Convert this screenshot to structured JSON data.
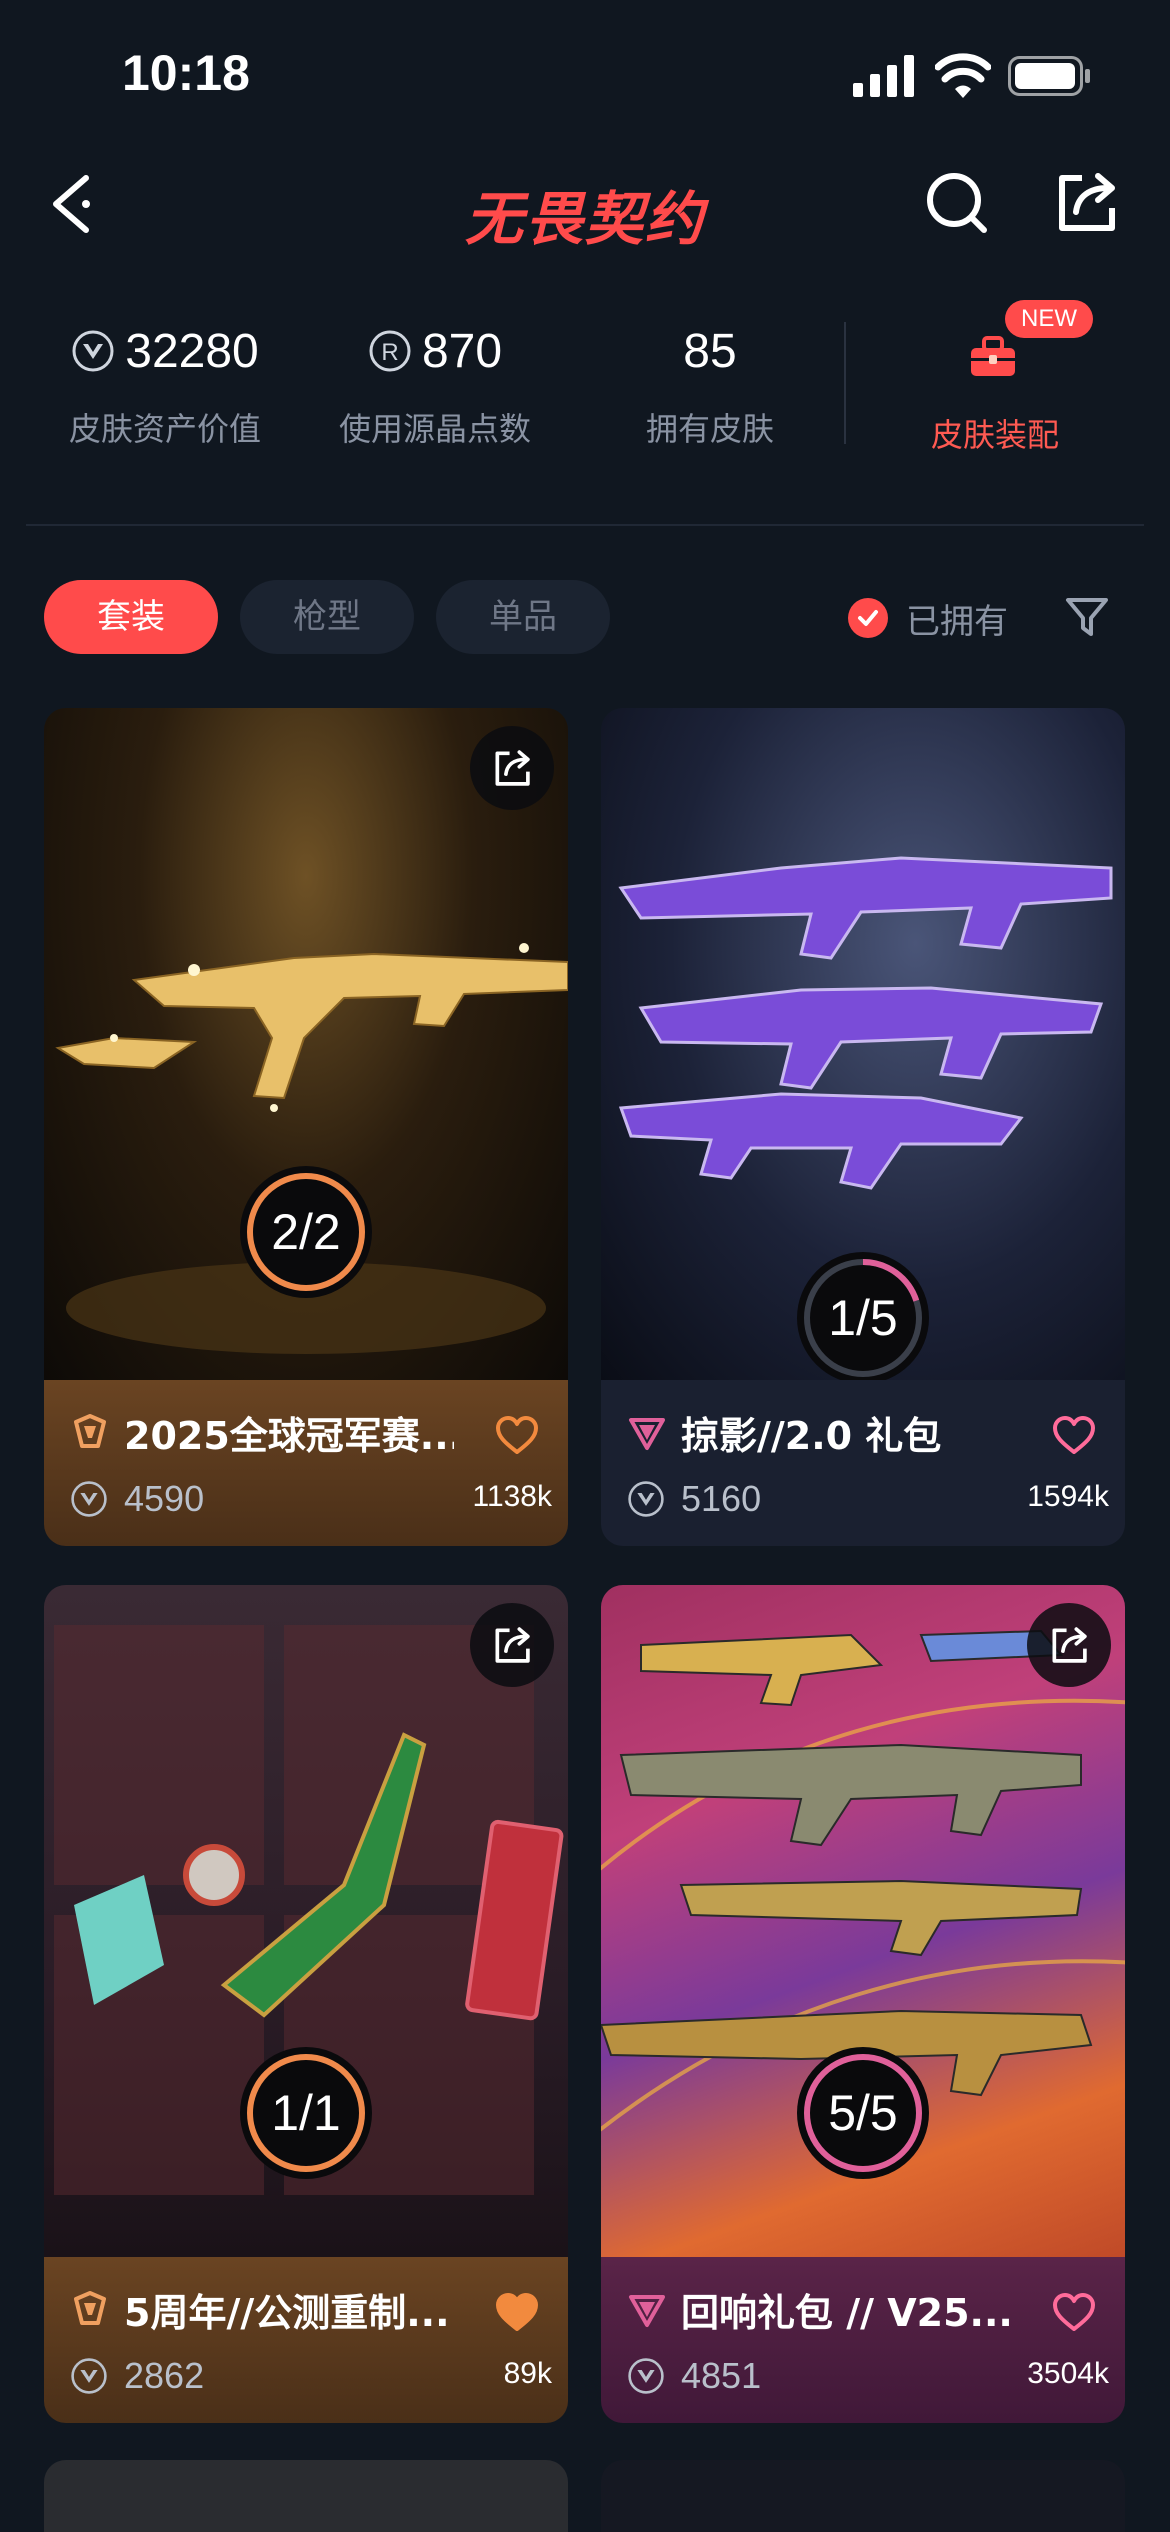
{
  "status_bar": {
    "time": "10:18",
    "icons": [
      "signal-icon",
      "wifi-icon",
      "battery-icon"
    ]
  },
  "header": {
    "title": "无畏契约",
    "back_icon": "chevron-left-icon",
    "search_icon": "search-icon",
    "share_icon": "share-icon"
  },
  "stats": [
    {
      "value": "32280",
      "label": "皮肤资产价值",
      "icon": "vp-icon"
    },
    {
      "value": "870",
      "label": "使用源晶点数",
      "icon": "radianite-icon"
    },
    {
      "value": "85",
      "label": "拥有皮肤"
    }
  ],
  "equip": {
    "label": "皮肤装配",
    "badge": "NEW",
    "icon": "toolbox-icon"
  },
  "tabs": [
    {
      "label": "套装",
      "active": true
    },
    {
      "label": "枪型",
      "active": false
    },
    {
      "label": "单品",
      "active": false
    }
  ],
  "owned_filter": {
    "label": "已拥有",
    "checked": true
  },
  "cards": [
    {
      "title": "2025全球冠军赛...",
      "progress_label": "2/2",
      "progress": 1.0,
      "price": "4590",
      "likes": "1138k",
      "liked": false,
      "tier_color": "#f0a060"
    },
    {
      "title": "掠影//2.0 礼包",
      "progress_label": "1/5",
      "progress": 0.2,
      "price": "5160",
      "likes": "1594k",
      "liked": false,
      "tier_color": "#e0609a"
    },
    {
      "title": "5周年//公测重制...",
      "progress_label": "1/1",
      "progress": 1.0,
      "price": "2862",
      "likes": "89k",
      "liked": true,
      "tier_color": "#f0a060"
    },
    {
      "title": "回响礼包 // V25...",
      "progress_label": "5/5",
      "progress": 1.0,
      "price": "4851",
      "likes": "3504k",
      "liked": false,
      "tier_color": "#e0609a"
    }
  ],
  "colors": {
    "accent": "#ff4b4b",
    "gold_ring": "#f08a4b",
    "pink_ring": "#e0609a",
    "background": "#101720"
  }
}
